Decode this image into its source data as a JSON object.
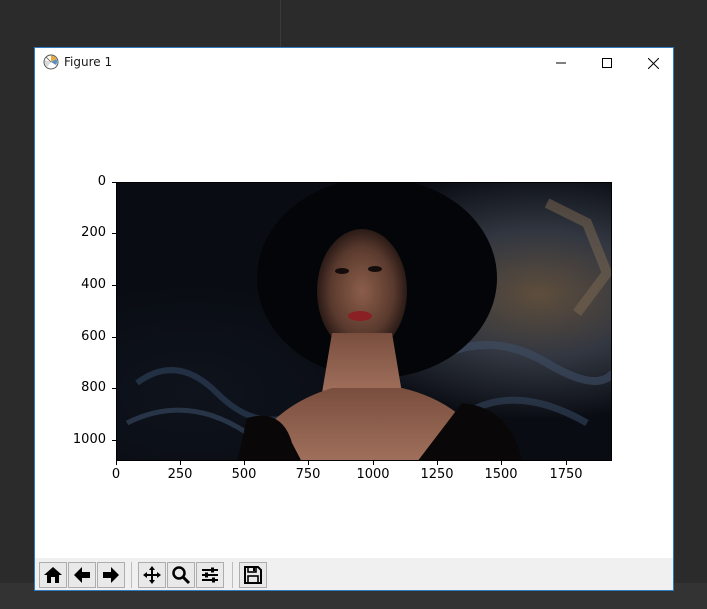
{
  "window": {
    "title": "Figure 1"
  },
  "colors": {
    "window_border": "#2f7bbf",
    "toolbar_bg": "#f0f0f0",
    "desktop_bg": "#2b2b2b"
  },
  "axes": {
    "y_ticks": [
      "0",
      "200",
      "400",
      "600",
      "800",
      "1000"
    ],
    "x_ticks": [
      "0",
      "250",
      "500",
      "750",
      "1000",
      "1250",
      "1500",
      "1750"
    ]
  },
  "image": {
    "description_icon": "image-icon"
  },
  "toolbar": {
    "buttons": [
      {
        "name": "home-button",
        "icon": "home-icon"
      },
      {
        "name": "back-button",
        "icon": "arrow-left-icon"
      },
      {
        "name": "forward-button",
        "icon": "arrow-right-icon"
      },
      {
        "name": "pan-button",
        "icon": "move-icon"
      },
      {
        "name": "zoom-button",
        "icon": "magnifier-icon"
      },
      {
        "name": "configure-subplots-button",
        "icon": "sliders-icon"
      },
      {
        "name": "save-button",
        "icon": "floppy-disk-icon"
      }
    ]
  }
}
